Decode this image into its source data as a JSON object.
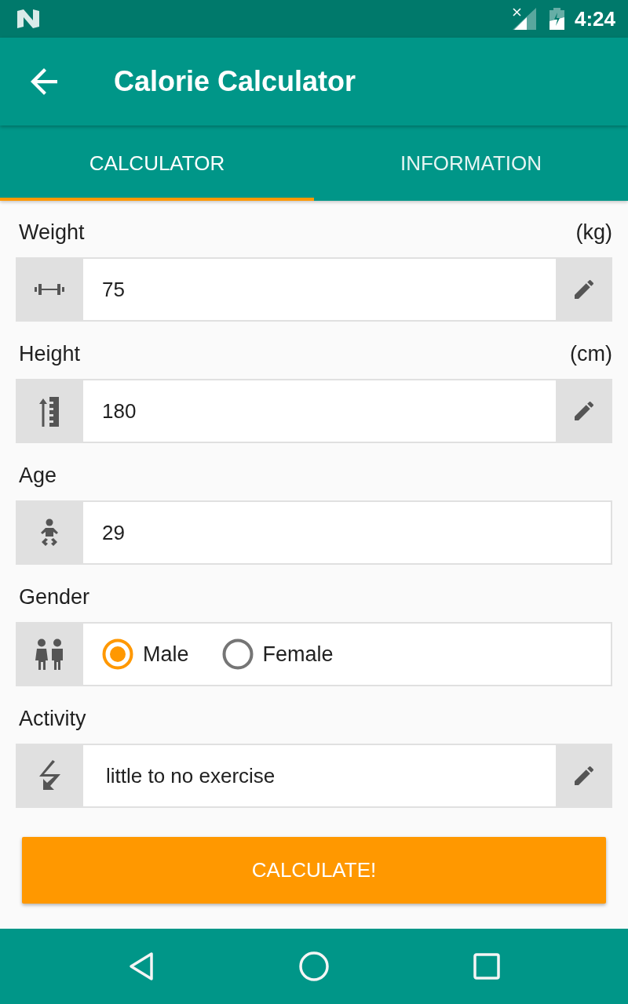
{
  "status_bar": {
    "time": "4:24"
  },
  "app_bar": {
    "title": "Calorie Calculator"
  },
  "tabs": [
    {
      "label": "CALCULATOR",
      "selected": true
    },
    {
      "label": "INFORMATION",
      "selected": false
    }
  ],
  "fields": [
    {
      "kind": "input",
      "label": "Weight",
      "unit": "(kg)",
      "value": "75",
      "editable": true
    },
    {
      "kind": "input",
      "label": "Height",
      "unit": "(cm)",
      "value": "180",
      "editable": true
    },
    {
      "kind": "input",
      "label": "Age",
      "value": "29",
      "editable": false
    },
    {
      "kind": "radio",
      "label": "Gender",
      "options": [
        {
          "label": "Male",
          "selected": true
        },
        {
          "label": "Female",
          "selected": false
        }
      ]
    },
    {
      "kind": "input",
      "label": "Activity",
      "value": "little to no exercise",
      "editable": true
    }
  ],
  "button": {
    "label": "CALCULATE!"
  }
}
